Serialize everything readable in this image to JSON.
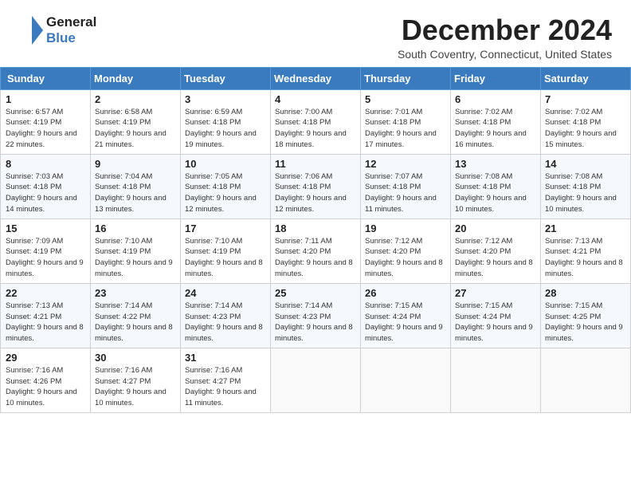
{
  "header": {
    "logo_line1": "General",
    "logo_line2": "Blue",
    "title": "December 2024",
    "subtitle": "South Coventry, Connecticut, United States"
  },
  "days_of_week": [
    "Sunday",
    "Monday",
    "Tuesday",
    "Wednesday",
    "Thursday",
    "Friday",
    "Saturday"
  ],
  "weeks": [
    [
      {
        "day": "1",
        "sunrise": "6:57 AM",
        "sunset": "4:19 PM",
        "daylight": "9 hours and 22 minutes."
      },
      {
        "day": "2",
        "sunrise": "6:58 AM",
        "sunset": "4:19 PM",
        "daylight": "9 hours and 21 minutes."
      },
      {
        "day": "3",
        "sunrise": "6:59 AM",
        "sunset": "4:18 PM",
        "daylight": "9 hours and 19 minutes."
      },
      {
        "day": "4",
        "sunrise": "7:00 AM",
        "sunset": "4:18 PM",
        "daylight": "9 hours and 18 minutes."
      },
      {
        "day": "5",
        "sunrise": "7:01 AM",
        "sunset": "4:18 PM",
        "daylight": "9 hours and 17 minutes."
      },
      {
        "day": "6",
        "sunrise": "7:02 AM",
        "sunset": "4:18 PM",
        "daylight": "9 hours and 16 minutes."
      },
      {
        "day": "7",
        "sunrise": "7:02 AM",
        "sunset": "4:18 PM",
        "daylight": "9 hours and 15 minutes."
      }
    ],
    [
      {
        "day": "8",
        "sunrise": "7:03 AM",
        "sunset": "4:18 PM",
        "daylight": "9 hours and 14 minutes."
      },
      {
        "day": "9",
        "sunrise": "7:04 AM",
        "sunset": "4:18 PM",
        "daylight": "9 hours and 13 minutes."
      },
      {
        "day": "10",
        "sunrise": "7:05 AM",
        "sunset": "4:18 PM",
        "daylight": "9 hours and 12 minutes."
      },
      {
        "day": "11",
        "sunrise": "7:06 AM",
        "sunset": "4:18 PM",
        "daylight": "9 hours and 12 minutes."
      },
      {
        "day": "12",
        "sunrise": "7:07 AM",
        "sunset": "4:18 PM",
        "daylight": "9 hours and 11 minutes."
      },
      {
        "day": "13",
        "sunrise": "7:08 AM",
        "sunset": "4:18 PM",
        "daylight": "9 hours and 10 minutes."
      },
      {
        "day": "14",
        "sunrise": "7:08 AM",
        "sunset": "4:18 PM",
        "daylight": "9 hours and 10 minutes."
      }
    ],
    [
      {
        "day": "15",
        "sunrise": "7:09 AM",
        "sunset": "4:19 PM",
        "daylight": "9 hours and 9 minutes."
      },
      {
        "day": "16",
        "sunrise": "7:10 AM",
        "sunset": "4:19 PM",
        "daylight": "9 hours and 9 minutes."
      },
      {
        "day": "17",
        "sunrise": "7:10 AM",
        "sunset": "4:19 PM",
        "daylight": "9 hours and 8 minutes."
      },
      {
        "day": "18",
        "sunrise": "7:11 AM",
        "sunset": "4:20 PM",
        "daylight": "9 hours and 8 minutes."
      },
      {
        "day": "19",
        "sunrise": "7:12 AM",
        "sunset": "4:20 PM",
        "daylight": "9 hours and 8 minutes."
      },
      {
        "day": "20",
        "sunrise": "7:12 AM",
        "sunset": "4:20 PM",
        "daylight": "9 hours and 8 minutes."
      },
      {
        "day": "21",
        "sunrise": "7:13 AM",
        "sunset": "4:21 PM",
        "daylight": "9 hours and 8 minutes."
      }
    ],
    [
      {
        "day": "22",
        "sunrise": "7:13 AM",
        "sunset": "4:21 PM",
        "daylight": "9 hours and 8 minutes."
      },
      {
        "day": "23",
        "sunrise": "7:14 AM",
        "sunset": "4:22 PM",
        "daylight": "9 hours and 8 minutes."
      },
      {
        "day": "24",
        "sunrise": "7:14 AM",
        "sunset": "4:23 PM",
        "daylight": "9 hours and 8 minutes."
      },
      {
        "day": "25",
        "sunrise": "7:14 AM",
        "sunset": "4:23 PM",
        "daylight": "9 hours and 8 minutes."
      },
      {
        "day": "26",
        "sunrise": "7:15 AM",
        "sunset": "4:24 PM",
        "daylight": "9 hours and 9 minutes."
      },
      {
        "day": "27",
        "sunrise": "7:15 AM",
        "sunset": "4:24 PM",
        "daylight": "9 hours and 9 minutes."
      },
      {
        "day": "28",
        "sunrise": "7:15 AM",
        "sunset": "4:25 PM",
        "daylight": "9 hours and 9 minutes."
      }
    ],
    [
      {
        "day": "29",
        "sunrise": "7:16 AM",
        "sunset": "4:26 PM",
        "daylight": "9 hours and 10 minutes."
      },
      {
        "day": "30",
        "sunrise": "7:16 AM",
        "sunset": "4:27 PM",
        "daylight": "9 hours and 10 minutes."
      },
      {
        "day": "31",
        "sunrise": "7:16 AM",
        "sunset": "4:27 PM",
        "daylight": "9 hours and 11 minutes."
      },
      null,
      null,
      null,
      null
    ]
  ],
  "labels": {
    "sunrise": "Sunrise:",
    "sunset": "Sunset:",
    "daylight": "Daylight:"
  }
}
